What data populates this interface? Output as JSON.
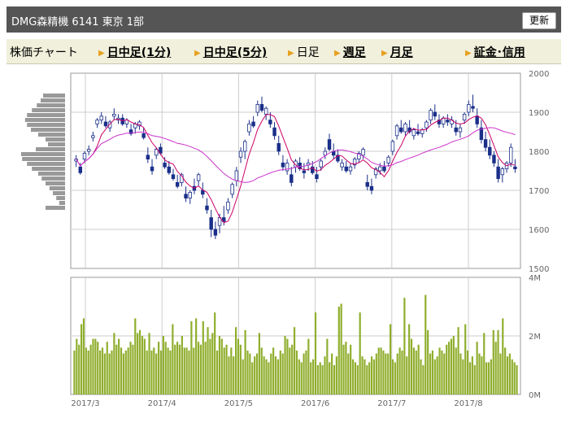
{
  "header": {
    "title": "DMG森精機  6141  東京 1部",
    "refresh_label": "更新"
  },
  "tabs": [
    {
      "label": "株価チャート",
      "active": true
    },
    {
      "label": "日中足(1分)",
      "link": true
    },
    {
      "label": "日中足(5分)",
      "link": true
    },
    {
      "label": "日足",
      "selected": true
    },
    {
      "label": "週足",
      "link": true
    },
    {
      "label": "月足",
      "link": true
    },
    {
      "label": "証金･信用",
      "link": true
    }
  ],
  "colors": {
    "up": "#ffffff",
    "down": "#1a2f8a",
    "candle_outline": "#1a2f8a",
    "ma_short": "#cc0066",
    "ma_long": "#cc33cc",
    "volume": "#8fae2d",
    "volume_profile": "#999999",
    "grid": "#cccccc",
    "frame": "#999999"
  },
  "chart_data": [
    {
      "type": "candlestick",
      "ylim": [
        1500,
        2000
      ],
      "yticks": [
        "2000",
        "1900",
        "1800",
        "1700",
        "1600",
        "1500"
      ],
      "ma_short_label": "",
      "ma_long_label": "",
      "candles": [
        [
          1775,
          1790,
          1760,
          1780
        ],
        [
          1760,
          1770,
          1740,
          1745
        ],
        [
          1780,
          1800,
          1770,
          1795
        ],
        [
          1800,
          1815,
          1790,
          1805
        ],
        [
          1835,
          1850,
          1825,
          1840
        ],
        [
          1870,
          1885,
          1860,
          1880
        ],
        [
          1880,
          1900,
          1870,
          1890
        ],
        [
          1875,
          1890,
          1860,
          1865
        ],
        [
          1860,
          1880,
          1850,
          1875
        ],
        [
          1890,
          1910,
          1880,
          1895
        ],
        [
          1880,
          1895,
          1870,
          1885
        ],
        [
          1885,
          1895,
          1865,
          1870
        ],
        [
          1870,
          1885,
          1860,
          1880
        ],
        [
          1855,
          1870,
          1840,
          1845
        ],
        [
          1860,
          1875,
          1845,
          1870
        ],
        [
          1865,
          1880,
          1855,
          1875
        ],
        [
          1845,
          1860,
          1830,
          1835
        ],
        [
          1790,
          1810,
          1770,
          1780
        ],
        [
          1760,
          1780,
          1740,
          1750
        ],
        [
          1790,
          1810,
          1780,
          1805
        ],
        [
          1810,
          1820,
          1790,
          1795
        ],
        [
          1770,
          1785,
          1755,
          1760
        ],
        [
          1760,
          1775,
          1740,
          1745
        ],
        [
          1740,
          1755,
          1725,
          1730
        ],
        [
          1720,
          1740,
          1705,
          1710
        ],
        [
          1720,
          1745,
          1710,
          1740
        ],
        [
          1690,
          1710,
          1670,
          1680
        ],
        [
          1680,
          1700,
          1665,
          1695
        ],
        [
          1710,
          1730,
          1690,
          1700
        ],
        [
          1725,
          1745,
          1710,
          1740
        ],
        [
          1700,
          1720,
          1680,
          1690
        ],
        [
          1660,
          1680,
          1640,
          1650
        ],
        [
          1630,
          1650,
          1580,
          1600
        ],
        [
          1600,
          1620,
          1575,
          1585
        ],
        [
          1610,
          1640,
          1590,
          1630
        ],
        [
          1630,
          1660,
          1610,
          1620
        ],
        [
          1650,
          1680,
          1640,
          1670
        ],
        [
          1690,
          1720,
          1680,
          1715
        ],
        [
          1725,
          1760,
          1710,
          1750
        ],
        [
          1785,
          1810,
          1770,
          1800
        ],
        [
          1800,
          1830,
          1780,
          1825
        ],
        [
          1850,
          1880,
          1840,
          1870
        ],
        [
          1875,
          1890,
          1860,
          1865
        ],
        [
          1900,
          1930,
          1890,
          1920
        ],
        [
          1920,
          1940,
          1900,
          1905
        ],
        [
          1895,
          1915,
          1880,
          1910
        ],
        [
          1880,
          1900,
          1860,
          1870
        ],
        [
          1860,
          1875,
          1830,
          1840
        ],
        [
          1820,
          1840,
          1790,
          1800
        ],
        [
          1770,
          1790,
          1750,
          1760
        ],
        [
          1750,
          1780,
          1740,
          1770
        ],
        [
          1740,
          1760,
          1710,
          1720
        ],
        [
          1760,
          1780,
          1745,
          1775
        ],
        [
          1770,
          1785,
          1750,
          1755
        ],
        [
          1750,
          1770,
          1730,
          1745
        ],
        [
          1765,
          1780,
          1750,
          1770
        ],
        [
          1760,
          1775,
          1740,
          1745
        ],
        [
          1740,
          1760,
          1720,
          1730
        ],
        [
          1760,
          1780,
          1750,
          1775
        ],
        [
          1790,
          1810,
          1780,
          1800
        ],
        [
          1830,
          1845,
          1800,
          1805
        ],
        [
          1800,
          1820,
          1780,
          1790
        ],
        [
          1790,
          1805,
          1770,
          1775
        ],
        [
          1760,
          1780,
          1750,
          1770
        ],
        [
          1760,
          1775,
          1745,
          1750
        ],
        [
          1750,
          1770,
          1740,
          1760
        ],
        [
          1765,
          1785,
          1755,
          1780
        ],
        [
          1780,
          1800,
          1770,
          1795
        ],
        [
          1790,
          1810,
          1780,
          1805
        ],
        [
          1720,
          1740,
          1700,
          1710
        ],
        [
          1710,
          1730,
          1690,
          1700
        ],
        [
          1740,
          1760,
          1730,
          1755
        ],
        [
          1750,
          1770,
          1740,
          1760
        ],
        [
          1760,
          1775,
          1745,
          1750
        ],
        [
          1770,
          1790,
          1760,
          1785
        ],
        [
          1800,
          1830,
          1790,
          1825
        ],
        [
          1840,
          1870,
          1830,
          1865
        ],
        [
          1860,
          1880,
          1845,
          1850
        ],
        [
          1850,
          1875,
          1840,
          1870
        ],
        [
          1860,
          1880,
          1845,
          1850
        ],
        [
          1840,
          1860,
          1830,
          1855
        ],
        [
          1850,
          1870,
          1840,
          1845
        ],
        [
          1845,
          1860,
          1835,
          1855
        ],
        [
          1860,
          1880,
          1850,
          1875
        ],
        [
          1880,
          1910,
          1870,
          1905
        ],
        [
          1900,
          1920,
          1880,
          1890
        ],
        [
          1880,
          1895,
          1860,
          1870
        ],
        [
          1870,
          1890,
          1860,
          1885
        ],
        [
          1880,
          1895,
          1865,
          1875
        ],
        [
          1870,
          1890,
          1860,
          1880
        ],
        [
          1860,
          1880,
          1840,
          1850
        ],
        [
          1850,
          1870,
          1835,
          1860
        ],
        [
          1880,
          1900,
          1870,
          1895
        ],
        [
          1900,
          1930,
          1890,
          1920
        ],
        [
          1915,
          1945,
          1900,
          1910
        ],
        [
          1890,
          1910,
          1860,
          1870
        ],
        [
          1860,
          1880,
          1820,
          1830
        ],
        [
          1830,
          1850,
          1800,
          1810
        ],
        [
          1810,
          1830,
          1780,
          1790
        ],
        [
          1790,
          1800,
          1760,
          1770
        ],
        [
          1760,
          1780,
          1720,
          1730
        ],
        [
          1740,
          1760,
          1720,
          1755
        ],
        [
          1755,
          1775,
          1745,
          1770
        ],
        [
          1770,
          1820,
          1760,
          1810
        ],
        [
          1760,
          1780,
          1745,
          1755
        ]
      ],
      "ma_short": [],
      "ma_long": [],
      "volume_profile": [
        0.45,
        0.5,
        0.58,
        0.68,
        0.78,
        0.82,
        0.78,
        0.7,
        0.55,
        0.4,
        0.35,
        0.6,
        0.9,
        0.88,
        0.78,
        0.68,
        0.55,
        0.48,
        0.4,
        0.32,
        0.25,
        0.18,
        0.12,
        0.4
      ]
    },
    {
      "type": "bar",
      "ylim": [
        0,
        4
      ],
      "yticks": [
        "4M",
        "2M",
        "0M"
      ],
      "xtick_labels": [
        "2017/3",
        "2017/4",
        "2017/5",
        "2017/6",
        "2017/7",
        "2017/8"
      ],
      "values": [
        1.5,
        1.9,
        1.7,
        2.4,
        2.6,
        1.6,
        1.5,
        1.7,
        1.9,
        1.9,
        1.8,
        1.5,
        1.6,
        1.4,
        1.8,
        1.4,
        1.5,
        2.1,
        1.7,
        1.9,
        1.6,
        1.4,
        1.5,
        1.6,
        1.8,
        1.7,
        2.6,
        2.1,
        2.2,
        2.0,
        1.9,
        1.5,
        2.1,
        1.5,
        1.6,
        1.4,
        1.8,
        1.5,
        2.0,
        1.8,
        1.6,
        1.5,
        2.4,
        1.7,
        1.8,
        1.7,
        2.0,
        1.6,
        1.6,
        1.5,
        2.5,
        1.6,
        2.6,
        1.8,
        1.7,
        2.5,
        1.8,
        2.3,
        1.9,
        2.1,
        2.8,
        1.5,
        2.0,
        1.9,
        1.6,
        1.7,
        1.3,
        1.6,
        1.3,
        2.3,
        1.9,
        1.7,
        1.2,
        2.2,
        1.5,
        1.4,
        1.1,
        1.3,
        1.4,
        2.1,
        1.6,
        1.3,
        1.2,
        1.1,
        1.4,
        1.6,
        1.3,
        1.2,
        1.5,
        1.4,
        2.0,
        1.9,
        1.6,
        1.7,
        2.3,
        1.5,
        1.2,
        1.1,
        1.4,
        1.5,
        1.9,
        1.1,
        1.2,
        2.8,
        1.0,
        1.1,
        1.0,
        1.3,
        1.9,
        1.1,
        1.4,
        1.0,
        1.3,
        3.0,
        3.1,
        1.7,
        1.8,
        1.4,
        1.7,
        1.2,
        1.1,
        1.0,
        2.8,
        1.3,
        1.2,
        1.0,
        1.1,
        1.3,
        1.2,
        1.4,
        1.6,
        1.6,
        1.5,
        1.4,
        1.4,
        2.4,
        1.2,
        1.1,
        1.4,
        1.6,
        1.5,
        3.3,
        1.3,
        2.4,
        1.9,
        1.6,
        1.5,
        1.7,
        1.2,
        1.0,
        3.4,
        2.2,
        1.4,
        1.5,
        1.2,
        1.3,
        1.6,
        1.5,
        1.4,
        1.7,
        1.8,
        1.9,
        2.0,
        1.6,
        2.3,
        1.4,
        1.2,
        2.4,
        1.5,
        1.1,
        1.3,
        1.0,
        1.8,
        1.4,
        1.3,
        2.1,
        1.1,
        1.1,
        1.2,
        2.2,
        1.8,
        2.2,
        1.4,
        2.6,
        1.6,
        1.3,
        1.4,
        1.2,
        1.1,
        1.0
      ]
    }
  ]
}
